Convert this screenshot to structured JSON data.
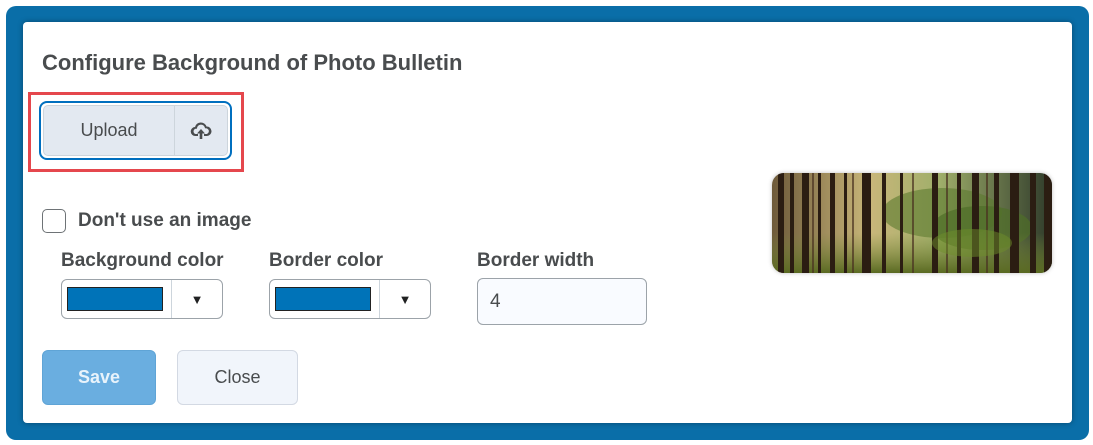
{
  "dialog": {
    "title": "Configure Background of Photo Bulletin"
  },
  "upload": {
    "label": "Upload",
    "icon": "cloud-upload-icon"
  },
  "no_image": {
    "label": "Don't use an image",
    "checked": false
  },
  "background_color": {
    "label": "Background color",
    "value": "#0073b8"
  },
  "border_color": {
    "label": "Border color",
    "value": "#0073b8"
  },
  "border_width": {
    "label": "Border width",
    "value": "4"
  },
  "buttons": {
    "save": "Save",
    "close": "Close"
  },
  "preview": {
    "icon": "forest-image"
  },
  "colors": {
    "frame": "#0a6ea8",
    "highlight": "#e5474d",
    "save_disabled": "#6aaee0"
  }
}
